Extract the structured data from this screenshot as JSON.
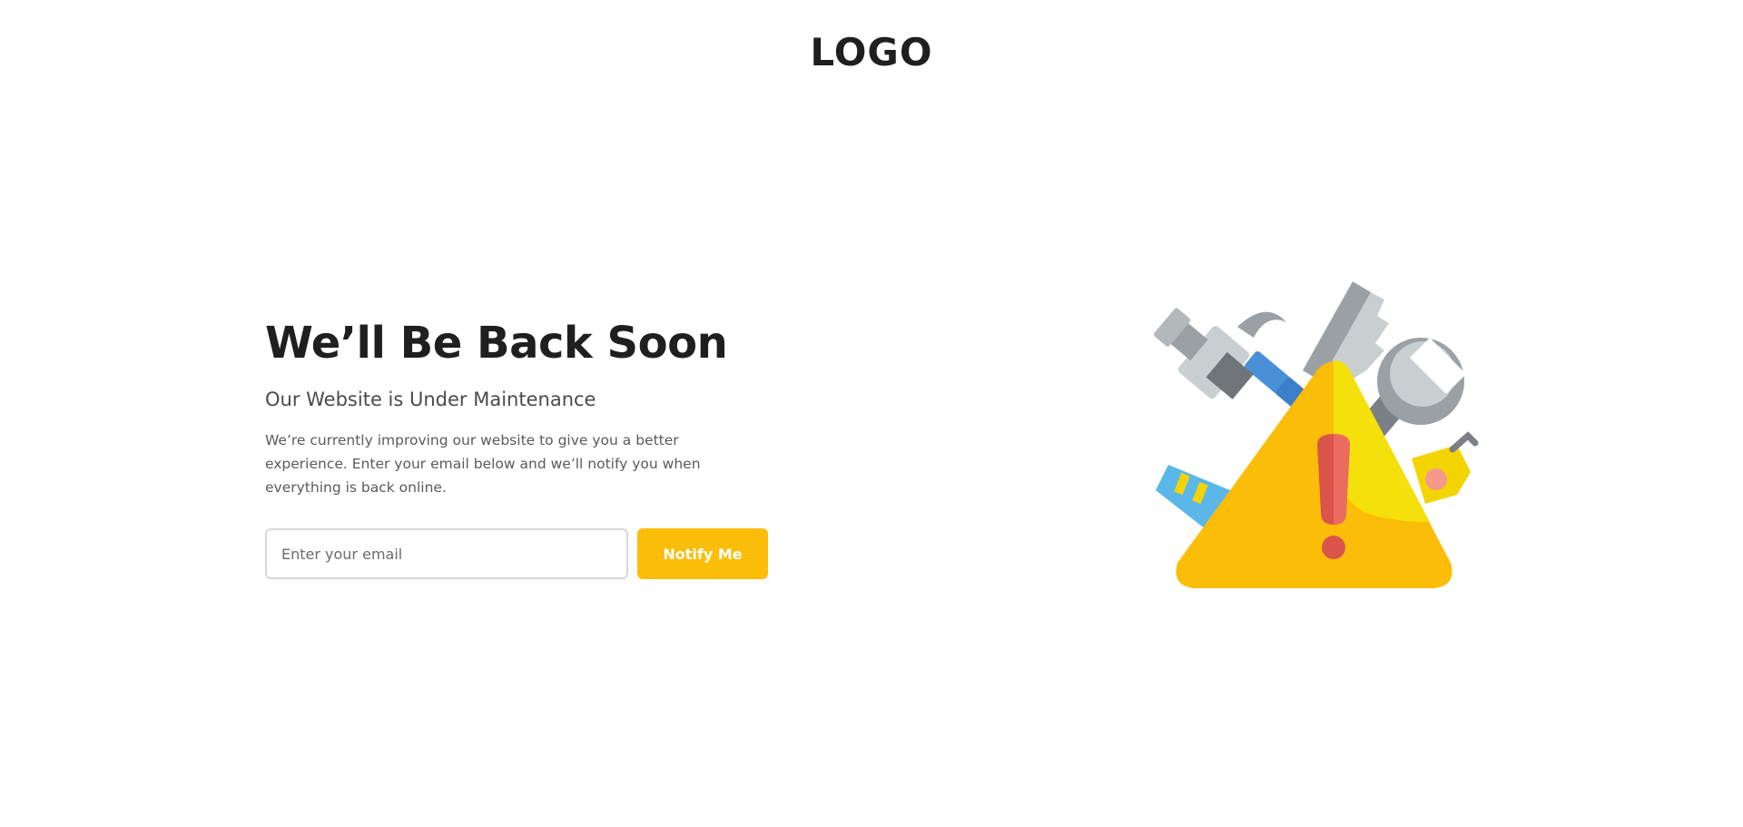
{
  "header": {
    "logo_text": "LOGO"
  },
  "main": {
    "headline": "We’ll Be Back Soon",
    "subheadline": "Our Website is Under Maintenance",
    "description": "We’re currently improving our website to give you a better experience. Enter your email below and we’ll notify you when everything is back online.",
    "email_placeholder": "Enter your email",
    "notify_button_label": "Notify Me"
  },
  "colors": {
    "accent": "#fbbd08",
    "text_dark": "#1f1f1f",
    "text_muted": "#5a5a5a"
  },
  "illustration": {
    "icon": "maintenance-warning-tools-icon"
  }
}
